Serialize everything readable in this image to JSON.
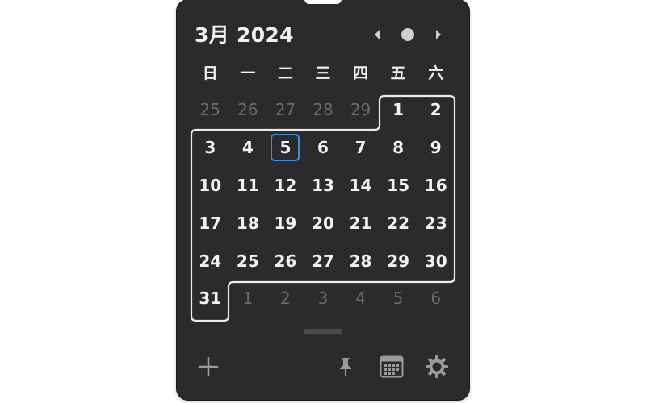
{
  "header": {
    "title": "3月 2024"
  },
  "weekdays": [
    "日",
    "一",
    "二",
    "三",
    "四",
    "五",
    "六"
  ],
  "days": [
    {
      "label": "25",
      "in_month": false
    },
    {
      "label": "26",
      "in_month": false
    },
    {
      "label": "27",
      "in_month": false
    },
    {
      "label": "28",
      "in_month": false
    },
    {
      "label": "29",
      "in_month": false
    },
    {
      "label": "1",
      "in_month": true
    },
    {
      "label": "2",
      "in_month": true
    },
    {
      "label": "3",
      "in_month": true
    },
    {
      "label": "4",
      "in_month": true
    },
    {
      "label": "5",
      "in_month": true,
      "today": true
    },
    {
      "label": "6",
      "in_month": true
    },
    {
      "label": "7",
      "in_month": true
    },
    {
      "label": "8",
      "in_month": true
    },
    {
      "label": "9",
      "in_month": true
    },
    {
      "label": "10",
      "in_month": true
    },
    {
      "label": "11",
      "in_month": true
    },
    {
      "label": "12",
      "in_month": true
    },
    {
      "label": "13",
      "in_month": true
    },
    {
      "label": "14",
      "in_month": true
    },
    {
      "label": "15",
      "in_month": true
    },
    {
      "label": "16",
      "in_month": true
    },
    {
      "label": "17",
      "in_month": true
    },
    {
      "label": "18",
      "in_month": true
    },
    {
      "label": "19",
      "in_month": true
    },
    {
      "label": "20",
      "in_month": true
    },
    {
      "label": "21",
      "in_month": true
    },
    {
      "label": "22",
      "in_month": true
    },
    {
      "label": "23",
      "in_month": true
    },
    {
      "label": "24",
      "in_month": true
    },
    {
      "label": "25",
      "in_month": true
    },
    {
      "label": "26",
      "in_month": true
    },
    {
      "label": "27",
      "in_month": true
    },
    {
      "label": "28",
      "in_month": true
    },
    {
      "label": "29",
      "in_month": true
    },
    {
      "label": "30",
      "in_month": true
    },
    {
      "label": "31",
      "in_month": true
    },
    {
      "label": "1",
      "in_month": false
    },
    {
      "label": "2",
      "in_month": false
    },
    {
      "label": "3",
      "in_month": false
    },
    {
      "label": "4",
      "in_month": false
    },
    {
      "label": "5",
      "in_month": false
    },
    {
      "label": "6",
      "in_month": false
    }
  ],
  "toolbar": {
    "add_icon": "plus-icon",
    "pin_icon": "pin-icon",
    "calendar_icon": "calendar-icon",
    "settings_icon": "gear-icon"
  },
  "colors": {
    "background": "#2b2b2d",
    "today_outline": "#3a8ee8",
    "month_outline": "#ebebeb",
    "dim_text": "#6b6b6e"
  }
}
